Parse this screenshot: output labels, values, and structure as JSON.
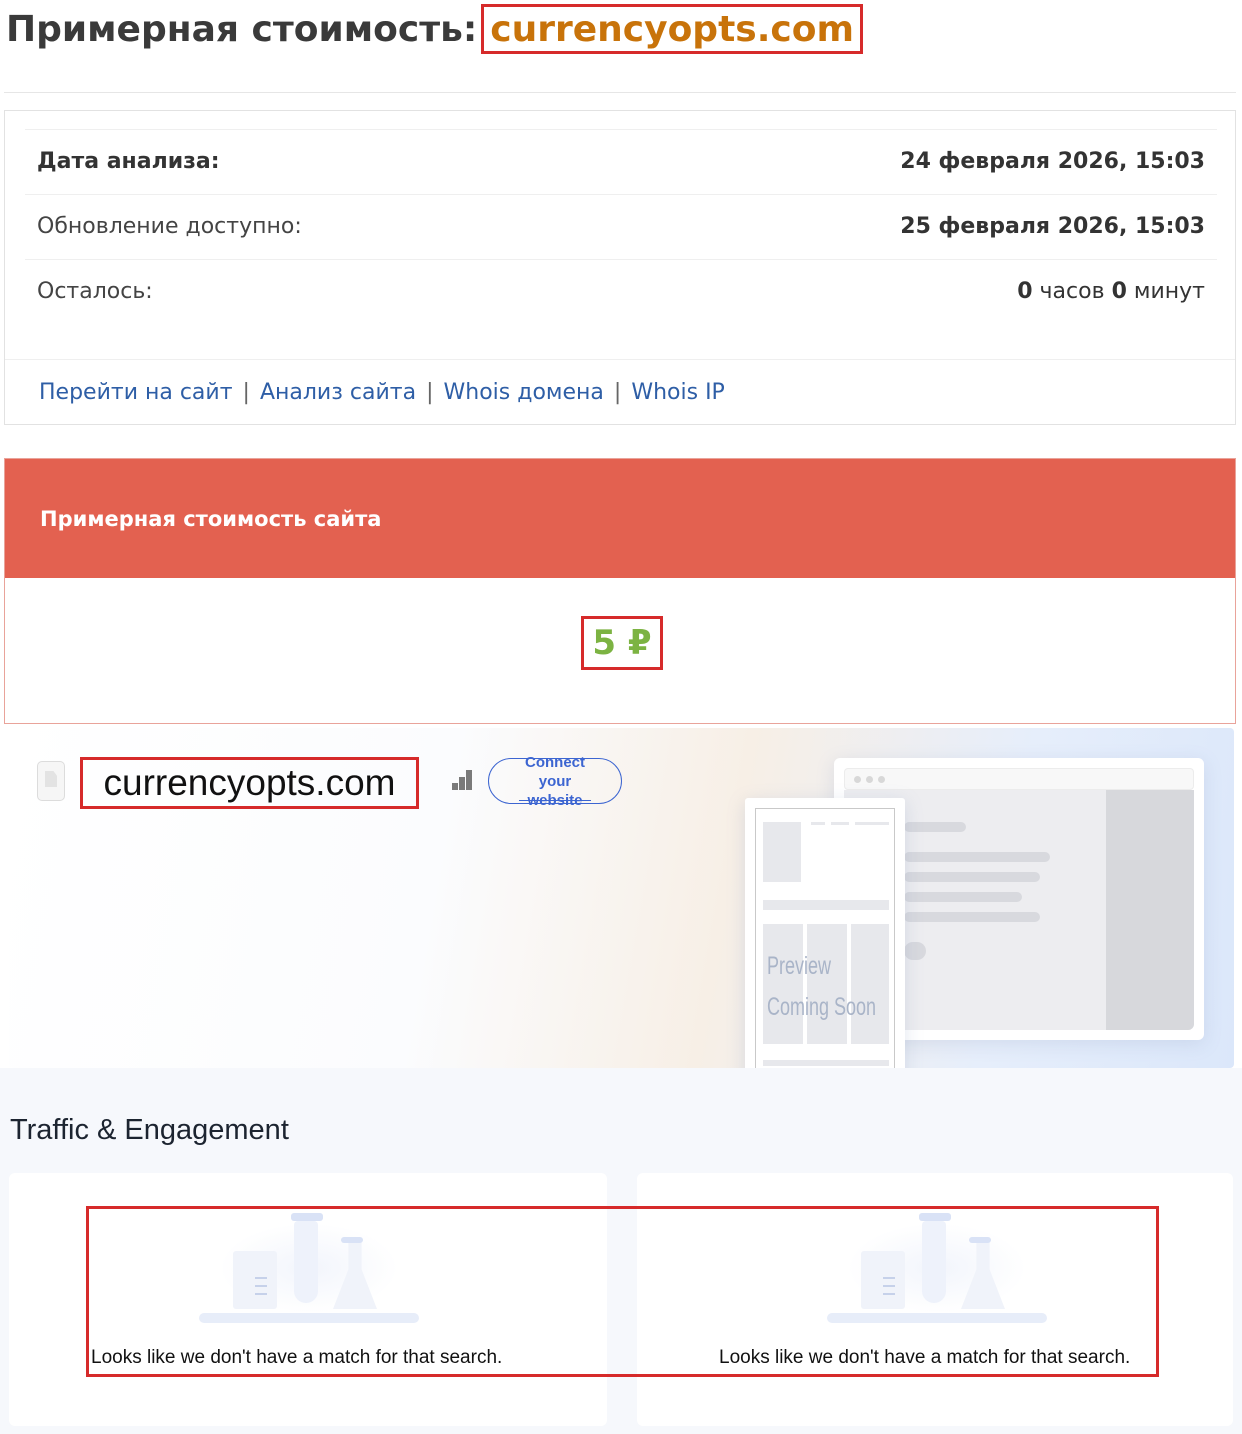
{
  "header": {
    "title_prefix": "Примерная стоимость:",
    "domain": "currencyopts.com"
  },
  "info": {
    "rows": [
      {
        "label": "Дата анализа:",
        "value": "24 февраля 2026, 15:03"
      },
      {
        "label": "Обновление доступно:",
        "value": "25 февраля 2026, 15:03"
      }
    ],
    "remaining": {
      "label": "Осталось:",
      "hours_value": "0",
      "hours_unit": "часов",
      "minutes_value": "0",
      "minutes_unit": "минут"
    },
    "links": [
      "Перейти на сайт",
      "Анализ сайта",
      "Whois домена",
      "Whois IP"
    ],
    "link_separator": "|"
  },
  "value_panel": {
    "heading": "Примерная стоимость сайта",
    "amount": "5 ₽"
  },
  "site_card": {
    "domain": "currencyopts.com",
    "connect_button": "Connect your website",
    "preview_line1": "Preview",
    "preview_line2": "Coming Soon"
  },
  "traffic": {
    "title": "Traffic & Engagement",
    "cards": [
      {
        "message": "Looks like we don't have a match for that search."
      },
      {
        "message": "Looks like we don't have a match for that search."
      }
    ]
  },
  "colors": {
    "domain_accent": "#c8730a",
    "value_header": "#e36150",
    "value_amount": "#7cb342",
    "link": "#2e5ea6",
    "connect_button": "#3c65d1",
    "highlight_outline": "#d62a2a"
  }
}
